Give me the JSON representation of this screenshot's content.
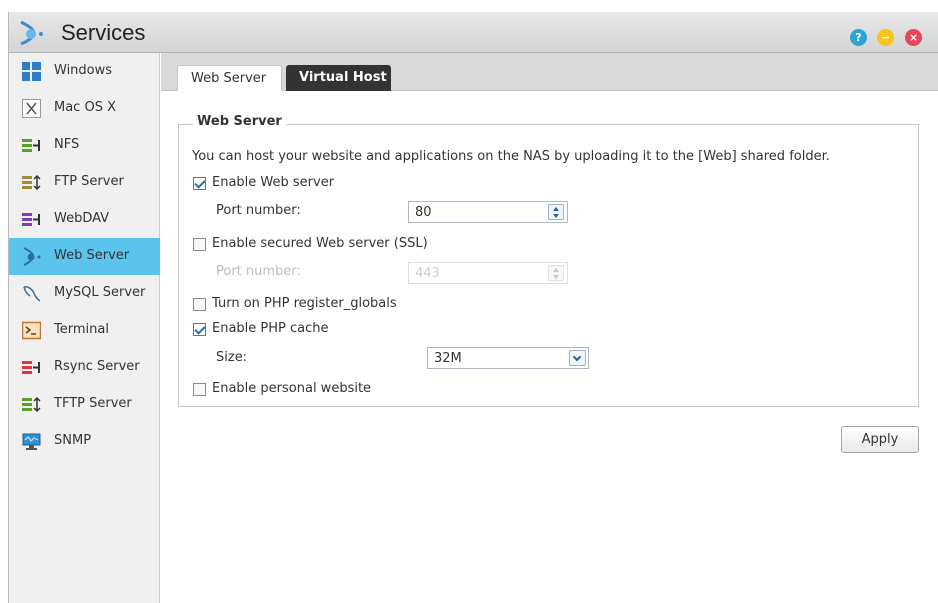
{
  "window": {
    "title": "Services",
    "controls": {
      "help": "?",
      "minimize": "−",
      "close": "×"
    }
  },
  "sidebar": {
    "items": [
      {
        "label": "Windows",
        "icon": "windows-icon"
      },
      {
        "label": "Mac OS X",
        "icon": "macos-icon"
      },
      {
        "label": "NFS",
        "icon": "nfs-icon"
      },
      {
        "label": "FTP Server",
        "icon": "ftp-server-icon"
      },
      {
        "label": "WebDAV",
        "icon": "webdav-icon"
      },
      {
        "label": "Web Server",
        "icon": "web-server-icon",
        "active": true
      },
      {
        "label": "MySQL Server",
        "icon": "mysql-icon"
      },
      {
        "label": "Terminal",
        "icon": "terminal-icon"
      },
      {
        "label": "Rsync Server",
        "icon": "rsync-icon"
      },
      {
        "label": "TFTP Server",
        "icon": "tftp-icon"
      },
      {
        "label": "SNMP",
        "icon": "snmp-icon"
      }
    ]
  },
  "tabs": [
    {
      "label": "Web Server",
      "selected": true
    },
    {
      "label": "Virtual Host",
      "selected": false
    }
  ],
  "web_server": {
    "legend": "Web Server",
    "description": "You can host your website and applications on the NAS by uploading it to the [Web] shared folder.",
    "enable_web_server": {
      "label": "Enable Web server",
      "checked": true
    },
    "port": {
      "label": "Port number:",
      "value": "80"
    },
    "enable_ssl": {
      "label": "Enable secured Web server (SSL)",
      "checked": false
    },
    "ssl_port": {
      "label": "Port number:",
      "value": "443",
      "disabled": true
    },
    "register_globals": {
      "label": "Turn on PHP register_globals",
      "checked": false
    },
    "php_cache": {
      "label": "Enable PHP cache",
      "checked": true
    },
    "cache_size": {
      "label": "Size:",
      "value": "32M"
    },
    "personal_website": {
      "label": "Enable personal website",
      "checked": false
    }
  },
  "actions": {
    "apply_label": "Apply"
  },
  "colors": {
    "accent": "#5bc4ec",
    "active_tab": "#333333",
    "help": "#2aa6d6",
    "minimize": "#f6c51c",
    "close": "#e8465a"
  }
}
